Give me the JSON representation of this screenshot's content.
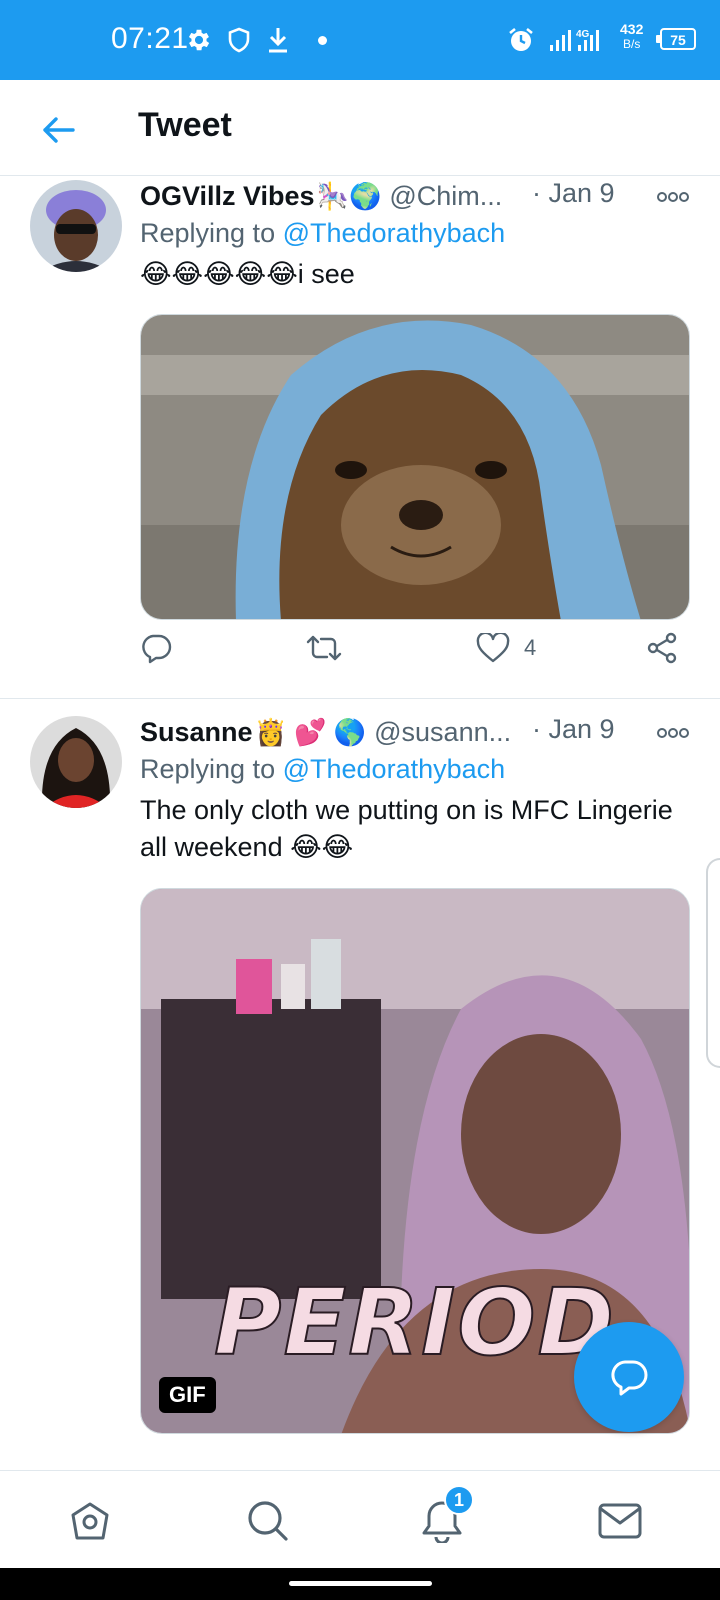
{
  "status_bar": {
    "time": "07:21",
    "network_speed_value": "432",
    "network_speed_unit": "B/s",
    "network_type": "4G",
    "battery": "75",
    "icons": [
      "settings-icon",
      "shield-icon",
      "download-icon",
      "alarm-icon",
      "signal-icon"
    ]
  },
  "header": {
    "title": "Tweet",
    "back_icon": "arrow-left-icon"
  },
  "tweets": [
    {
      "name": "OGVillz Vibes",
      "name_emoji": "🎠🌍",
      "handle": "@Chim...",
      "date": "· Jan 9",
      "reply_prefix": "Replying to",
      "reply_to": "@Thedorathybach",
      "text": "😂😂😂😂😂i see",
      "media_type": "image",
      "media_caption": "",
      "likes": "4",
      "retweets": "",
      "replies": ""
    },
    {
      "name": "Susanne",
      "name_emoji": "👸 💕 🌎",
      "handle": "@susann...",
      "date": "· Jan 9",
      "reply_prefix": "Replying to",
      "reply_to": "@Thedorathybach",
      "text": "The only cloth we putting on is MFC Lingerie all weekend 😂😂",
      "media_type": "gif",
      "media_caption": "PERIOD",
      "gif_label": "GIF"
    }
  ],
  "fab": {
    "icon": "compose-reply-icon"
  },
  "bottom_nav": {
    "items": [
      "home-icon",
      "search-icon",
      "notifications-icon",
      "messages-icon"
    ],
    "notification_count": "1"
  },
  "colors": {
    "accent": "#1d9bf0",
    "text": "#0f1419",
    "secondary_text": "#536471"
  }
}
